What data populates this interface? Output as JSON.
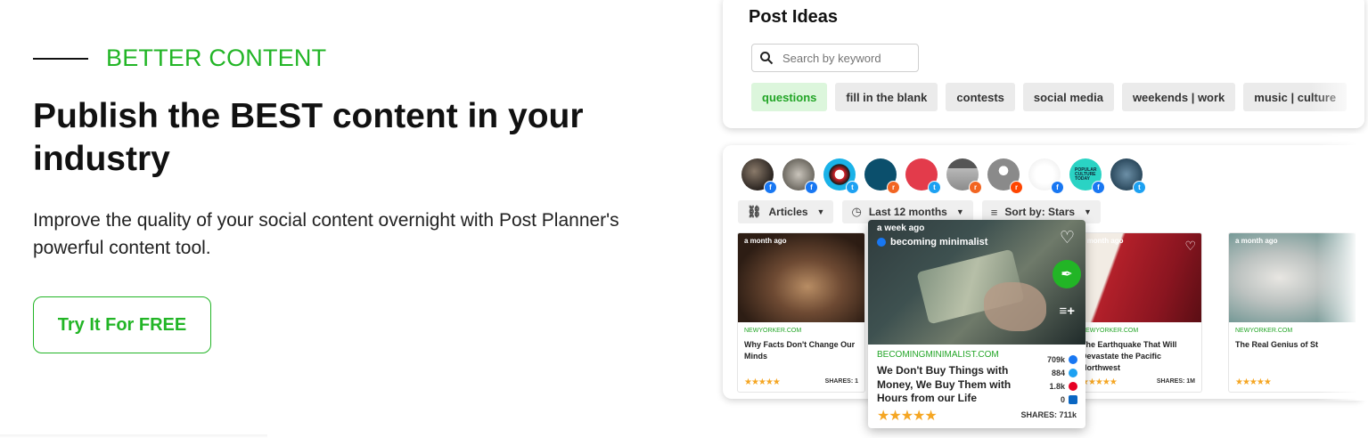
{
  "hero": {
    "eyebrow": "BETTER CONTENT",
    "headline": "Publish the BEST content in your industry",
    "subtext": "Improve the quality of your social content overnight with Post Planner's powerful content tool.",
    "cta_label": "Try It For FREE"
  },
  "post_ideas": {
    "title": "Post Ideas",
    "search_placeholder": "Search by keyword",
    "chips": [
      "questions",
      "fill in the blank",
      "contests",
      "social media",
      "weekends | work",
      "music | culture"
    ],
    "active_chip": "questions"
  },
  "sources": {
    "avatars": [
      {
        "network": "facebook"
      },
      {
        "network": "facebook"
      },
      {
        "network": "twitter"
      },
      {
        "network": "rss"
      },
      {
        "network": "twitter"
      },
      {
        "network": "rss"
      },
      {
        "network": "reddit"
      },
      {
        "network": "facebook"
      },
      {
        "network": "facebook",
        "label": "POPULAR CULTURE TODAY"
      },
      {
        "network": "twitter"
      }
    ],
    "filters": {
      "type": "Articles",
      "range": "Last 12 months",
      "sort": "Sort by: Stars"
    }
  },
  "articles": [
    {
      "ago": "a month ago",
      "source": "NEWYORKER.COM",
      "title": "Why Facts Don't Change Our Minds",
      "stars": "★★★★★",
      "shares": "SHARES: 1"
    },
    {
      "ago": "a month ago",
      "source": "NEWYORKER.COM",
      "title": "The Earthquake That Will Devastate the Pacific Northwest",
      "stars": "★★★★★",
      "shares": "SHARES: 1M"
    },
    {
      "ago": "a month ago",
      "source": "NEWYORKER.COM",
      "title": "The Real Genius of St",
      "stars": "★★★★★",
      "shares": ""
    }
  ],
  "featured": {
    "ago": "a week ago",
    "page": "becoming minimalist",
    "source": "BECOMINGMINIMALIST.COM",
    "title": "We Don't Buy Things with Money, We Buy Them with Hours from our Life",
    "stars": "★★★★★",
    "shares": "SHARES: 711k",
    "counts": [
      {
        "value": "709k",
        "network": "facebook",
        "color": "#1877f2"
      },
      {
        "value": "884",
        "network": "twitter",
        "color": "#1da1f2"
      },
      {
        "value": "1.8k",
        "network": "pinterest",
        "color": "#e60023"
      },
      {
        "value": "0",
        "network": "linkedin",
        "color": "#0a66c2"
      }
    ]
  },
  "colors": {
    "brand_green": "#22b526",
    "star": "#f5a623"
  }
}
